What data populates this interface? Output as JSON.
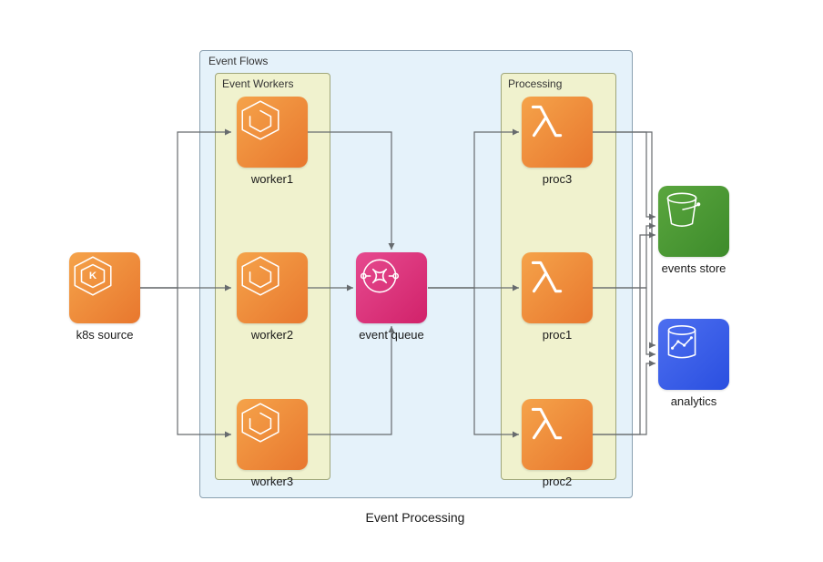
{
  "diagram": {
    "title": "Event Processing",
    "groups": {
      "flows": {
        "label": "Event Flows"
      },
      "workers": {
        "label": "Event Workers"
      },
      "processing": {
        "label": "Processing"
      }
    },
    "nodes": {
      "source": {
        "label": "k8s source",
        "type": "eks",
        "color": "orange"
      },
      "worker1": {
        "label": "worker1",
        "type": "ecs",
        "color": "orange"
      },
      "worker2": {
        "label": "worker2",
        "type": "ecs",
        "color": "orange"
      },
      "worker3": {
        "label": "worker3",
        "type": "ecs",
        "color": "orange"
      },
      "queue": {
        "label": "event queue",
        "type": "eventbridge",
        "color": "pink"
      },
      "proc1": {
        "label": "proc1",
        "type": "lambda",
        "color": "orange"
      },
      "proc2": {
        "label": "proc2",
        "type": "lambda",
        "color": "orange"
      },
      "proc3": {
        "label": "proc3",
        "type": "lambda",
        "color": "orange"
      },
      "store": {
        "label": "events store",
        "type": "s3",
        "color": "green"
      },
      "analytics": {
        "label": "analytics",
        "type": "glue",
        "color": "blue"
      }
    },
    "edges": [
      [
        "source",
        "worker1"
      ],
      [
        "source",
        "worker2"
      ],
      [
        "source",
        "worker3"
      ],
      [
        "worker1",
        "queue"
      ],
      [
        "worker2",
        "queue"
      ],
      [
        "worker3",
        "queue"
      ],
      [
        "queue",
        "proc1"
      ],
      [
        "queue",
        "proc2"
      ],
      [
        "queue",
        "proc3"
      ],
      [
        "proc1",
        "store"
      ],
      [
        "proc2",
        "store"
      ],
      [
        "proc3",
        "store"
      ],
      [
        "proc1",
        "analytics"
      ],
      [
        "proc2",
        "analytics"
      ],
      [
        "proc3",
        "analytics"
      ]
    ]
  }
}
